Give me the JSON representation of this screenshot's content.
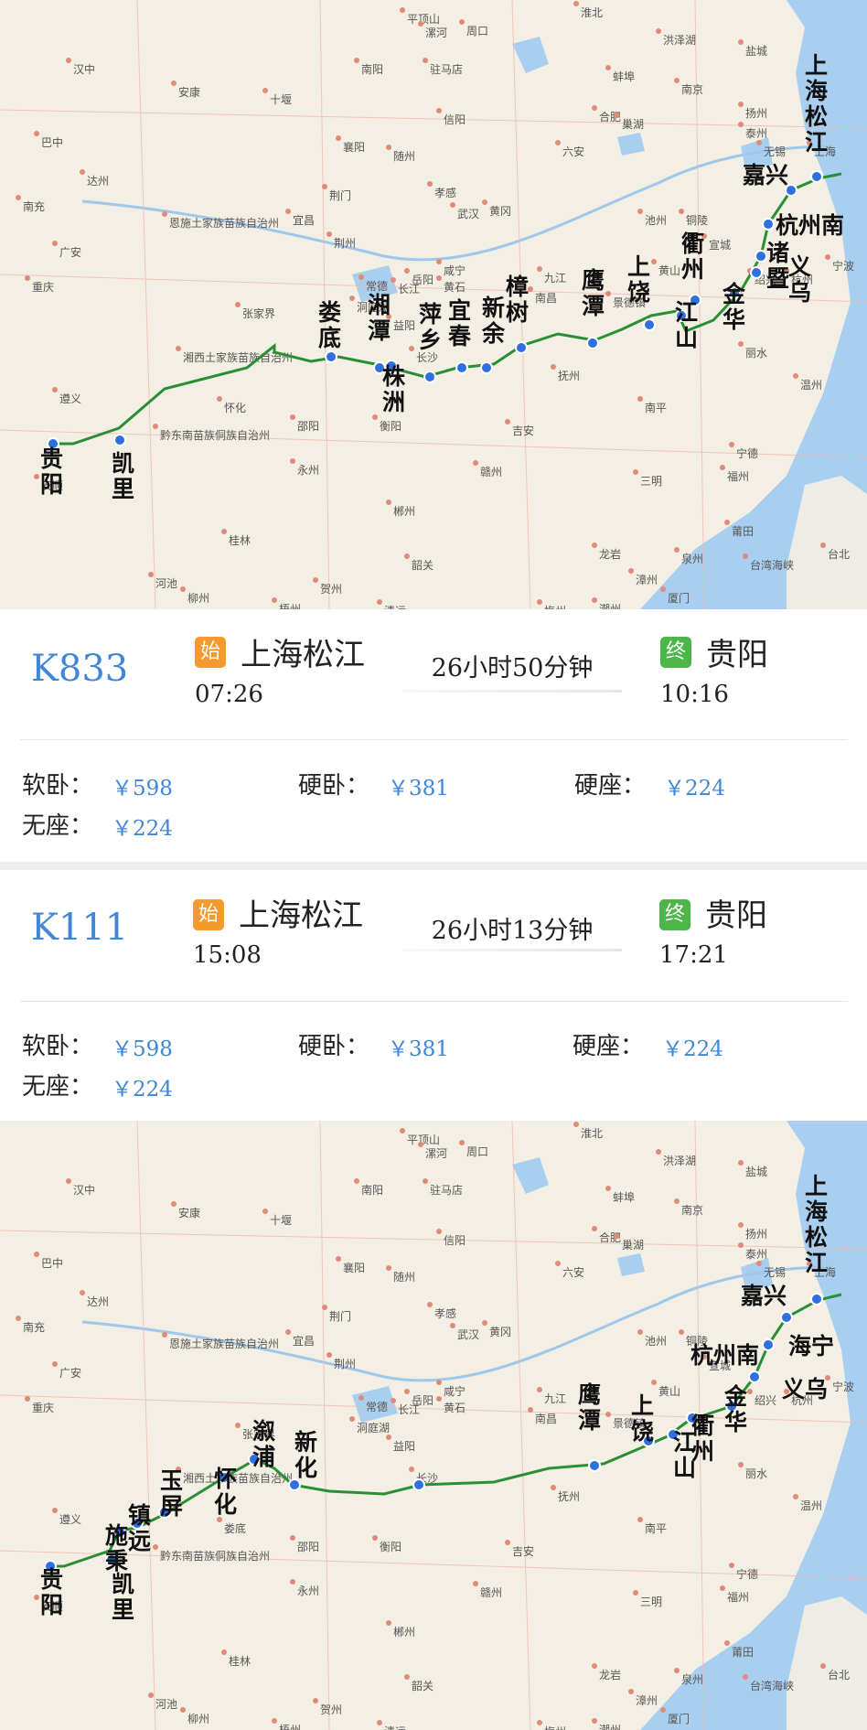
{
  "colors": {
    "route": "#2a8f34",
    "station_dot": "#2f6fe0",
    "train_number": "#3f87d8",
    "price": "#3f87d8",
    "start_badge": "#f59a2e",
    "end_badge": "#4cb648"
  },
  "maps": [
    {
      "stations": [
        "上海松江",
        "嘉兴",
        "杭州南",
        "诸暨",
        "义乌",
        "金华",
        "衢州",
        "江山",
        "上饶",
        "鹰潭",
        "樟树",
        "新余",
        "宜春",
        "萍乡",
        "株洲",
        "湘潭",
        "娄底",
        "凯里",
        "贵阳"
      ],
      "station_labels": [
        "上海松江",
        "嘉兴",
        "杭州南",
        "诸暨",
        "义乌",
        "金华",
        "衢州",
        "江山",
        "上饶",
        "鹰潭",
        "樟树",
        "新余",
        "宜春",
        "萍乡",
        "株洲",
        "湘潭",
        "娄底",
        "凯里",
        "贵阳"
      ],
      "base_cities": [
        "平顶山",
        "漯河",
        "周口",
        "淮北",
        "洪泽湖",
        "盐城",
        "汉中",
        "南阳",
        "驻马店",
        "蚌埠",
        "南京",
        "扬州",
        "安康",
        "十堰",
        "信阳",
        "合肥",
        "泰州",
        "巴中",
        "襄阳",
        "随州",
        "六安",
        "巢湖",
        "无锡",
        "上海",
        "达州",
        "荆门",
        "孝感",
        "武汉",
        "黄冈",
        "池州",
        "铜陵",
        "宣城",
        "南充",
        "恩施土家族苗族自治州",
        "宜昌",
        "荆州",
        "长江",
        "黄石",
        "九江",
        "景德镇",
        "杭州",
        "宁波",
        "广安",
        "岳阳",
        "咸宁",
        "黄山",
        "绍兴",
        "重庆",
        "张家界",
        "常德",
        "洞庭湖",
        "南昌",
        "丽水",
        "湘西土家族苗族自治州",
        "益阳",
        "长沙",
        "抚州",
        "温州",
        "遵义",
        "怀化",
        "邵阳",
        "衡阳",
        "吉安",
        "南平",
        "宁德",
        "黔东南苗族侗族自治州",
        "永州",
        "赣州",
        "三明",
        "福州",
        "安顺",
        "郴州",
        "莆田",
        "泉州",
        "桂林",
        "龙岩",
        "台北",
        "台湾海峡",
        "河池",
        "贺州",
        "韶关",
        "漳州",
        "厦门",
        "柳州",
        "梧州",
        "清远",
        "梅州",
        "潮州"
      ],
      "river_label": "长江",
      "lake_labels": [
        "洞庭湖",
        "洪泽湖",
        "太湖",
        "巢湖"
      ]
    },
    {
      "stations": [
        "上海松江",
        "嘉兴",
        "海宁",
        "杭州南",
        "义乌",
        "金华",
        "衢州",
        "江山",
        "上饶",
        "鹰潭",
        "长沙",
        "新化",
        "溆浦",
        "怀化",
        "玉屏",
        "镇远",
        "施秉",
        "凯里",
        "贵阳"
      ],
      "station_labels": [
        "上海松江",
        "嘉兴",
        "海宁",
        "杭州南",
        "义乌",
        "金华",
        "衢州",
        "江山",
        "上饶",
        "鹰潭",
        "新化",
        "溆浦",
        "怀化",
        "玉屏",
        "镇远",
        "施秉",
        "凯里",
        "贵阳"
      ],
      "base_cities": [
        "平顶山",
        "漯河",
        "周口",
        "淮北",
        "洪泽湖",
        "盐城",
        "汉中",
        "南阳",
        "驻马店",
        "蚌埠",
        "南京",
        "扬州",
        "安康",
        "十堰",
        "信阳",
        "合肥",
        "泰州",
        "巴中",
        "襄阳",
        "随州",
        "六安",
        "巢湖",
        "无锡",
        "上海",
        "达州",
        "荆门",
        "孝感",
        "武汉",
        "黄冈",
        "池州",
        "铜陵",
        "宣城",
        "南充",
        "恩施土家族苗族自治州",
        "宜昌",
        "荆州",
        "长江",
        "黄石",
        "九江",
        "景德镇",
        "杭州",
        "宁波",
        "广安",
        "岳阳",
        "咸宁",
        "黄山",
        "绍兴",
        "重庆",
        "张家界",
        "常德",
        "洞庭湖",
        "南昌",
        "丽水",
        "湘西土家族苗族自治州",
        "益阳",
        "长沙",
        "抚州",
        "温州",
        "遵义",
        "娄底",
        "邵阳",
        "衡阳",
        "吉安",
        "南平",
        "宁德",
        "黔东南苗族侗族自治州",
        "永州",
        "赣州",
        "三明",
        "福州",
        "安顺",
        "郴州",
        "莆田",
        "泉州",
        "桂林",
        "龙岩",
        "台北",
        "台湾海峡",
        "河池",
        "贺州",
        "韶关",
        "漳州",
        "厦门",
        "柳州",
        "梧州",
        "清远",
        "梅州",
        "潮州"
      ],
      "river_label": "长江",
      "lake_labels": [
        "洞庭湖",
        "洪泽湖",
        "太湖",
        "巢湖"
      ]
    }
  ],
  "trains": [
    {
      "number": "K833",
      "start_badge": "始",
      "from": "上海松江",
      "depart": "07:26",
      "duration": "26小时50分钟",
      "end_badge": "终",
      "to": "贵阳",
      "arrive": "10:16",
      "prices": [
        {
          "label": "软卧：",
          "value": "￥598"
        },
        {
          "label": "硬卧：",
          "value": "￥381"
        },
        {
          "label": "硬座：",
          "value": "￥224"
        },
        {
          "label": "无座：",
          "value": "￥224"
        }
      ]
    },
    {
      "number": "K111",
      "start_badge": "始",
      "from": "上海松江",
      "depart": "15:08",
      "duration": "26小时13分钟",
      "end_badge": "终",
      "to": "贵阳",
      "arrive": "17:21",
      "prices": [
        {
          "label": "软卧：",
          "value": "￥598"
        },
        {
          "label": "硬卧：",
          "value": "￥381"
        },
        {
          "label": "硬座：",
          "value": "￥224"
        },
        {
          "label": "无座：",
          "value": "￥224"
        }
      ]
    }
  ]
}
